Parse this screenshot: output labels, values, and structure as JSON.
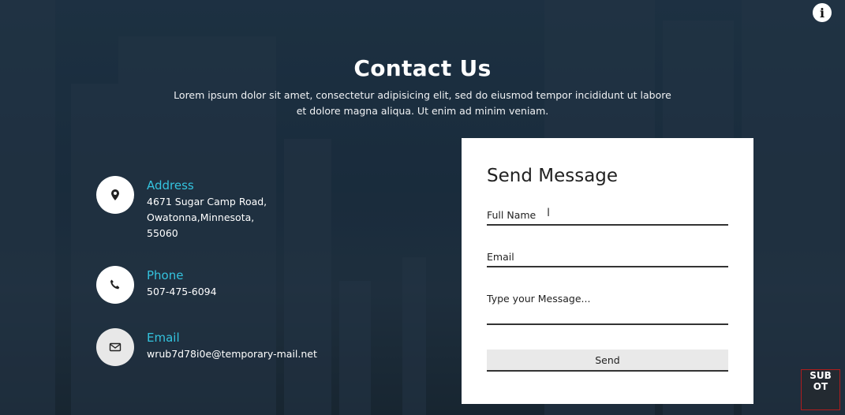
{
  "header": {
    "title": "Contact Us",
    "subtitle": "Lorem ipsum dolor sit amet, consectetur adipisicing elit, sed do eiusmod tempor incididunt ut labore et dolore magna aliqua. Ut enim ad minim veniam."
  },
  "contact": {
    "address": {
      "label": "Address",
      "value": "4671 Sugar Camp Road, Owatonna,Minnesota, 55060",
      "icon": "map-pin-icon"
    },
    "phone": {
      "label": "Phone",
      "value": "507-475-6094",
      "icon": "phone-icon"
    },
    "email": {
      "label": "Email",
      "value": "wrub7d78i0e@temporary-mail.net",
      "icon": "envelope-icon"
    }
  },
  "form": {
    "title": "Send Message",
    "full_name_placeholder": "Full Name",
    "email_placeholder": "Email",
    "message_placeholder": "Type your Message...",
    "send_label": "Send"
  },
  "overlay": {
    "info_glyph": "i",
    "logo_text": "SUB OT"
  },
  "colors": {
    "accent": "#34c3de",
    "background": "#1b2a37",
    "card": "#ffffff"
  }
}
